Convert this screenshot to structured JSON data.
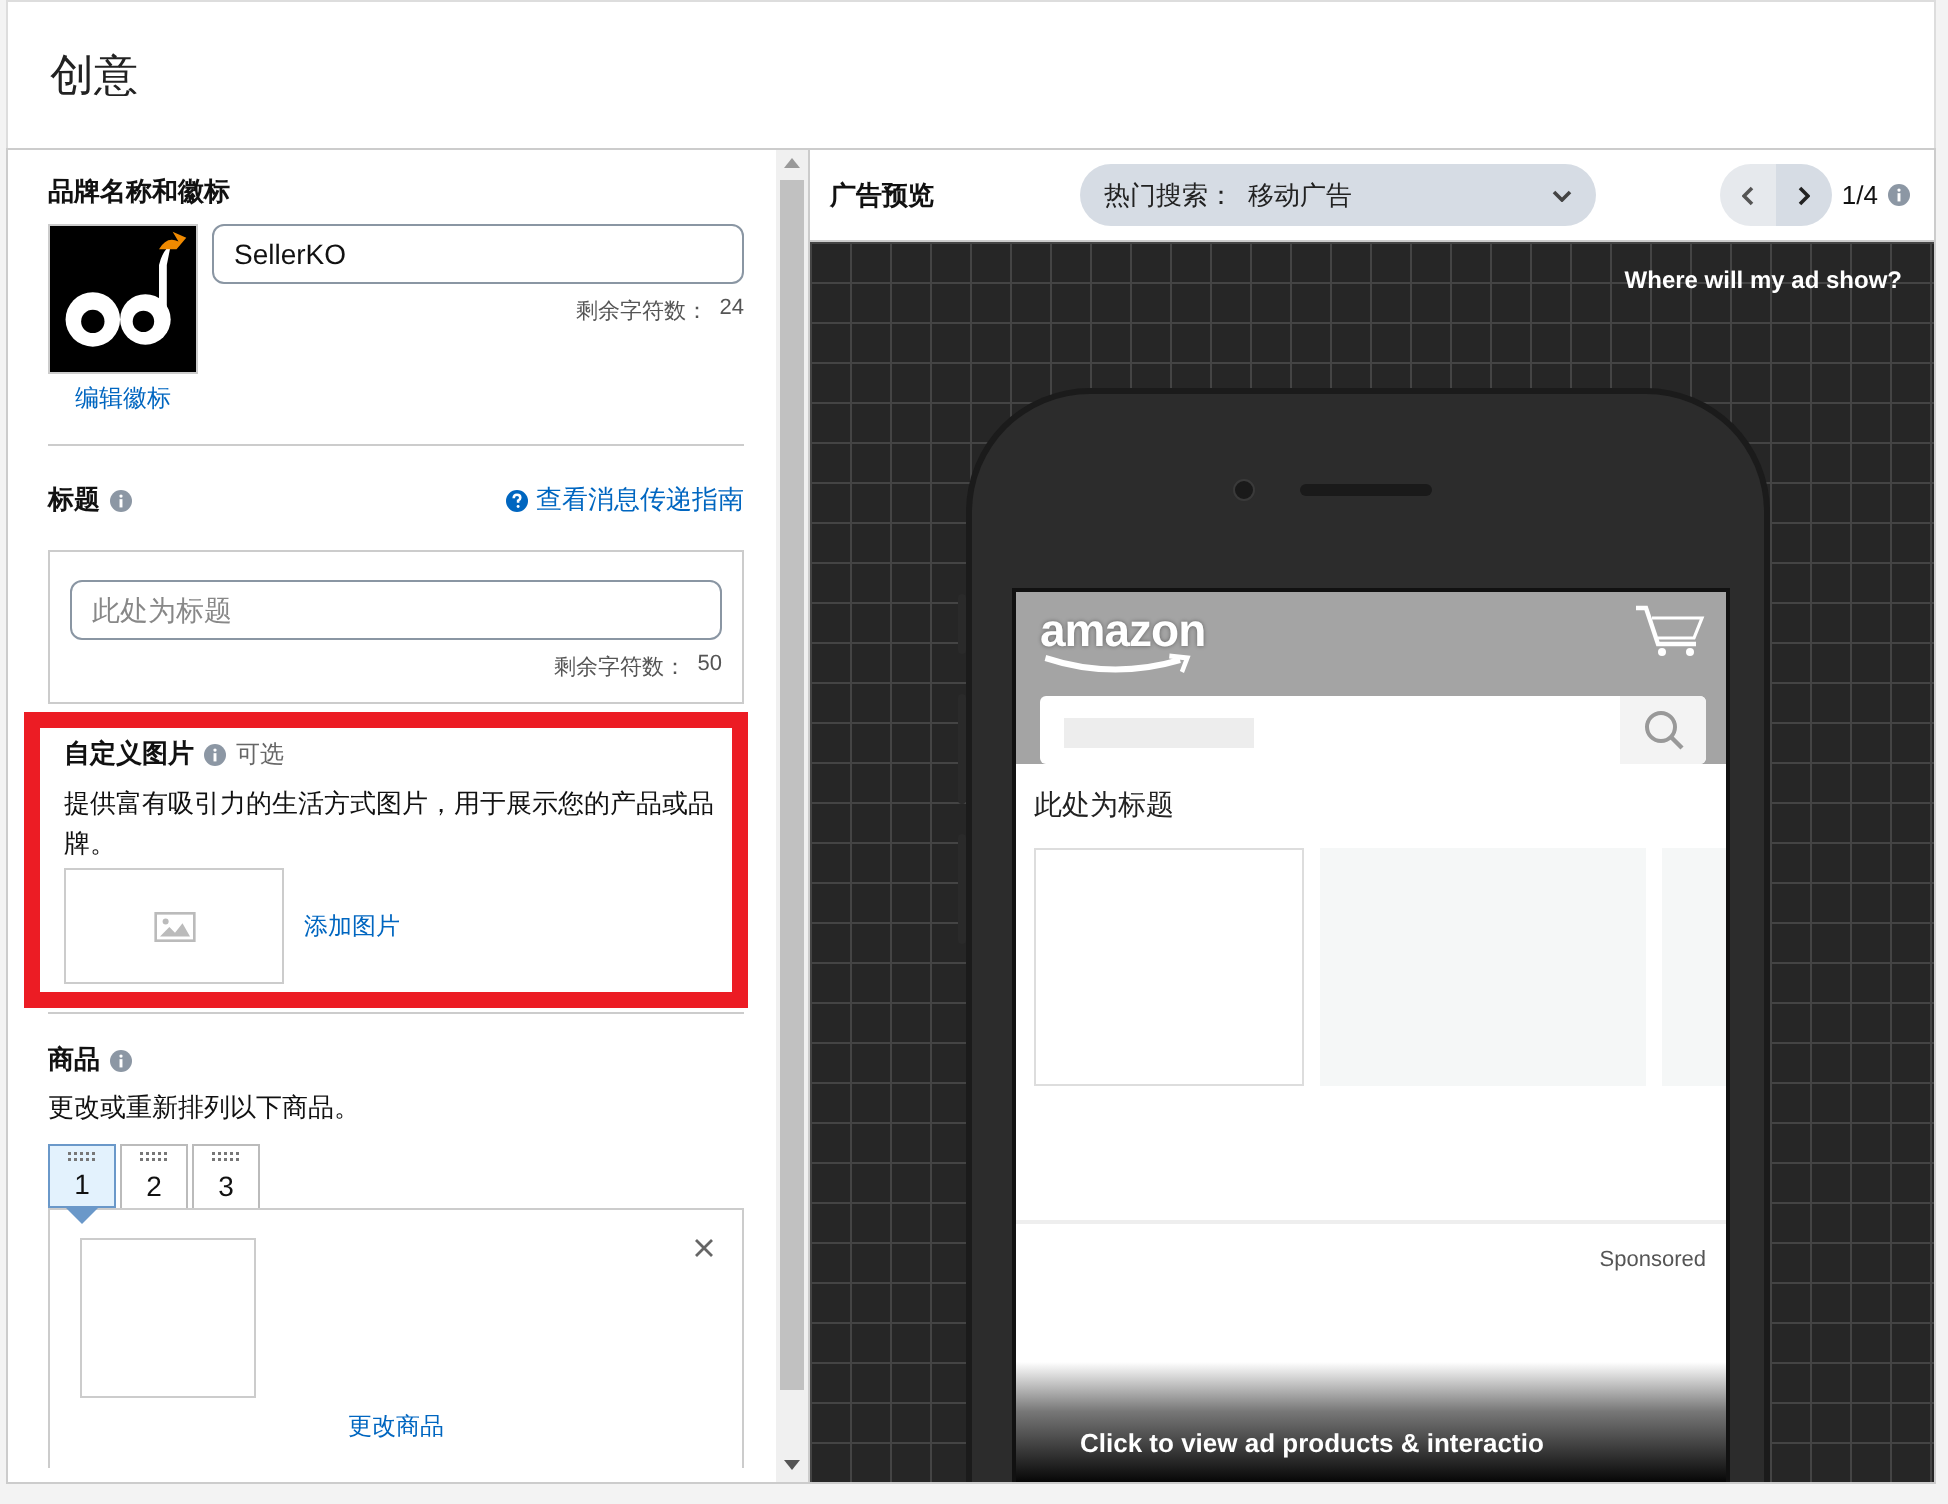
{
  "page_title": "创意",
  "brand": {
    "heading": "品牌名称和徽标",
    "edit_logo": "编辑徽标",
    "name_value": "SellerKO",
    "remaining_label": "剩余字符数：",
    "remaining": "24"
  },
  "headline": {
    "heading": "标题",
    "guide_link": "查看消息传递指南",
    "placeholder": "此处为标题",
    "remaining_label": "剩余字符数：",
    "remaining": "50"
  },
  "custom_image": {
    "heading": "自定义图片",
    "optional": "可选",
    "description": "提供富有吸引力的生活方式图片，用于展示您的产品或品牌。",
    "add_link": "添加图片",
    "highlighted": true
  },
  "products": {
    "heading": "商品",
    "description": "更改或重新排列以下商品。",
    "tabs": [
      {
        "label": "1",
        "selected": true
      },
      {
        "label": "2",
        "selected": false
      },
      {
        "label": "3",
        "selected": false
      }
    ],
    "change_link": "更改商品"
  },
  "preview": {
    "heading": "广告预览",
    "placement": "热门搜索：  移动广告",
    "page": "1/4",
    "where_link": "Where will my ad show?",
    "store_logo": "amazon",
    "ad_headline": "此处为标题",
    "sponsored": "Sponsored",
    "cta": "Click to view ad products & interactio"
  }
}
